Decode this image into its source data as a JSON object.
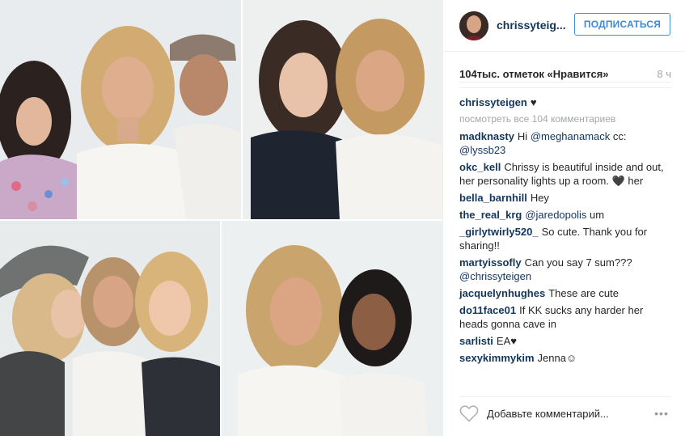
{
  "post": {
    "username": "chrissyteig...",
    "follow_label": "ПОДПИСАТЬСЯ",
    "likes_text": "104тыс. отметок «Нравится»",
    "time_ago": "8 ч"
  },
  "caption": {
    "user": "chrissyteigen",
    "text": "♥"
  },
  "view_all_label": "посмотреть все 104 комментариев",
  "comments": [
    {
      "user": "madknasty",
      "text": "Hi ",
      "mention": "@meghanamack",
      "tail": " cc: ",
      "mention2": "@lyssb23"
    },
    {
      "user": "okc_kell",
      "text": "Chrissy is beautiful inside and out, her personality lights up a room. 🖤 her",
      "mention": "",
      "tail": "",
      "mention2": ""
    },
    {
      "user": "bella_barnhill",
      "text": "Hey",
      "mention": "",
      "tail": "",
      "mention2": ""
    },
    {
      "user": "the_real_krg",
      "text": "",
      "mention": "@jaredopolis",
      "tail": " um",
      "mention2": ""
    },
    {
      "user": "_girlytwirly520_",
      "text": "So cute. Thank you for sharing!!",
      "mention": "",
      "tail": "",
      "mention2": ""
    },
    {
      "user": "martyissofly",
      "text": "Can you say 7 sum??? ",
      "mention": "@chrissyteigen",
      "tail": "",
      "mention2": ""
    },
    {
      "user": "jacquelynhughes",
      "text": "These are cute",
      "mention": "",
      "tail": "",
      "mention2": ""
    },
    {
      "user": "do11face01",
      "text": "If KK sucks any harder her heads gonna cave in",
      "mention": "",
      "tail": "",
      "mention2": ""
    },
    {
      "user": "sarlisti",
      "text": "EA♥",
      "mention": "",
      "tail": "",
      "mention2": ""
    },
    {
      "user": "sexykimmykim",
      "text": "Jenna☺",
      "mention": "",
      "tail": "",
      "mention2": ""
    }
  ],
  "footer": {
    "add_comment_placeholder": "Добавьте комментарий...",
    "more_label": "•••"
  },
  "icons": {
    "like": "heart-outline-icon",
    "more": "ellipsis-icon"
  },
  "colors": {
    "link": "#12365c",
    "follow": "#3f8ad0",
    "muted": "#a5a7aa"
  }
}
